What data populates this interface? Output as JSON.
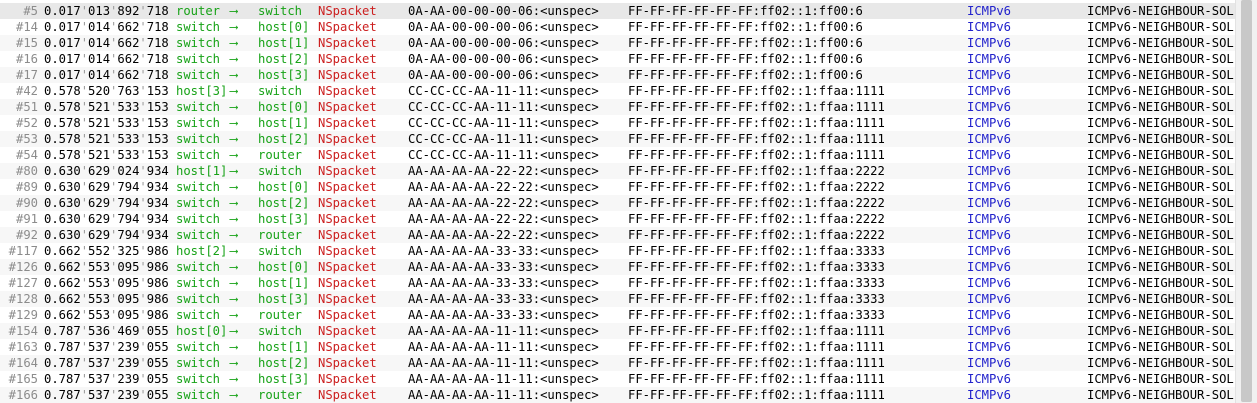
{
  "log": {
    "rows": [
      {
        "num": "#5",
        "t": [
          "0.017",
          "013",
          "892",
          "718"
        ],
        "src": "router",
        "arrow": "⟶",
        "dst": "switch",
        "name": "NSpacket",
        "srcaddr": "0A-AA-00-00-00-06:<unspec>",
        "dstaddr": "FF-FF-FF-FF-FF-FF:ff02::1:ff00:6",
        "proto": "ICMPv6",
        "kind": "ICMPv6-NEIGHBOUR-SOL"
      },
      {
        "num": "#14",
        "t": [
          "0.017",
          "014",
          "662",
          "718"
        ],
        "src": "switch",
        "arrow": "⟶",
        "dst": "host[0]",
        "name": "NSpacket",
        "srcaddr": "0A-AA-00-00-00-06:<unspec>",
        "dstaddr": "FF-FF-FF-FF-FF-FF:ff02::1:ff00:6",
        "proto": "ICMPv6",
        "kind": "ICMPv6-NEIGHBOUR-SOL"
      },
      {
        "num": "#15",
        "t": [
          "0.017",
          "014",
          "662",
          "718"
        ],
        "src": "switch",
        "arrow": "⟶",
        "dst": "host[1]",
        "name": "NSpacket",
        "srcaddr": "0A-AA-00-00-00-06:<unspec>",
        "dstaddr": "FF-FF-FF-FF-FF-FF:ff02::1:ff00:6",
        "proto": "ICMPv6",
        "kind": "ICMPv6-NEIGHBOUR-SOL"
      },
      {
        "num": "#16",
        "t": [
          "0.017",
          "014",
          "662",
          "718"
        ],
        "src": "switch",
        "arrow": "⟶",
        "dst": "host[2]",
        "name": "NSpacket",
        "srcaddr": "0A-AA-00-00-00-06:<unspec>",
        "dstaddr": "FF-FF-FF-FF-FF-FF:ff02::1:ff00:6",
        "proto": "ICMPv6",
        "kind": "ICMPv6-NEIGHBOUR-SOL"
      },
      {
        "num": "#17",
        "t": [
          "0.017",
          "014",
          "662",
          "718"
        ],
        "src": "switch",
        "arrow": "⟶",
        "dst": "host[3]",
        "name": "NSpacket",
        "srcaddr": "0A-AA-00-00-00-06:<unspec>",
        "dstaddr": "FF-FF-FF-FF-FF-FF:ff02::1:ff00:6",
        "proto": "ICMPv6",
        "kind": "ICMPv6-NEIGHBOUR-SOL"
      },
      {
        "num": "#42",
        "t": [
          "0.578",
          "520",
          "763",
          "153"
        ],
        "src": "host[3]",
        "arrow": "⟶",
        "dst": "switch",
        "name": "NSpacket",
        "srcaddr": "CC-CC-CC-AA-11-11:<unspec>",
        "dstaddr": "FF-FF-FF-FF-FF-FF:ff02::1:ffaa:1111",
        "proto": "ICMPv6",
        "kind": "ICMPv6-NEIGHBOUR-SOL"
      },
      {
        "num": "#51",
        "t": [
          "0.578",
          "521",
          "533",
          "153"
        ],
        "src": "switch",
        "arrow": "⟶",
        "dst": "host[0]",
        "name": "NSpacket",
        "srcaddr": "CC-CC-CC-AA-11-11:<unspec>",
        "dstaddr": "FF-FF-FF-FF-FF-FF:ff02::1:ffaa:1111",
        "proto": "ICMPv6",
        "kind": "ICMPv6-NEIGHBOUR-SOL"
      },
      {
        "num": "#52",
        "t": [
          "0.578",
          "521",
          "533",
          "153"
        ],
        "src": "switch",
        "arrow": "⟶",
        "dst": "host[1]",
        "name": "NSpacket",
        "srcaddr": "CC-CC-CC-AA-11-11:<unspec>",
        "dstaddr": "FF-FF-FF-FF-FF-FF:ff02::1:ffaa:1111",
        "proto": "ICMPv6",
        "kind": "ICMPv6-NEIGHBOUR-SOL"
      },
      {
        "num": "#53",
        "t": [
          "0.578",
          "521",
          "533",
          "153"
        ],
        "src": "switch",
        "arrow": "⟶",
        "dst": "host[2]",
        "name": "NSpacket",
        "srcaddr": "CC-CC-CC-AA-11-11:<unspec>",
        "dstaddr": "FF-FF-FF-FF-FF-FF:ff02::1:ffaa:1111",
        "proto": "ICMPv6",
        "kind": "ICMPv6-NEIGHBOUR-SOL"
      },
      {
        "num": "#54",
        "t": [
          "0.578",
          "521",
          "533",
          "153"
        ],
        "src": "switch",
        "arrow": "⟶",
        "dst": "router",
        "name": "NSpacket",
        "srcaddr": "CC-CC-CC-AA-11-11:<unspec>",
        "dstaddr": "FF-FF-FF-FF-FF-FF:ff02::1:ffaa:1111",
        "proto": "ICMPv6",
        "kind": "ICMPv6-NEIGHBOUR-SOL"
      },
      {
        "num": "#80",
        "t": [
          "0.630",
          "629",
          "024",
          "934"
        ],
        "src": "host[1]",
        "arrow": "⟶",
        "dst": "switch",
        "name": "NSpacket",
        "srcaddr": "AA-AA-AA-AA-22-22:<unspec>",
        "dstaddr": "FF-FF-FF-FF-FF-FF:ff02::1:ffaa:2222",
        "proto": "ICMPv6",
        "kind": "ICMPv6-NEIGHBOUR-SOL"
      },
      {
        "num": "#89",
        "t": [
          "0.630",
          "629",
          "794",
          "934"
        ],
        "src": "switch",
        "arrow": "⟶",
        "dst": "host[0]",
        "name": "NSpacket",
        "srcaddr": "AA-AA-AA-AA-22-22:<unspec>",
        "dstaddr": "FF-FF-FF-FF-FF-FF:ff02::1:ffaa:2222",
        "proto": "ICMPv6",
        "kind": "ICMPv6-NEIGHBOUR-SOL"
      },
      {
        "num": "#90",
        "t": [
          "0.630",
          "629",
          "794",
          "934"
        ],
        "src": "switch",
        "arrow": "⟶",
        "dst": "host[2]",
        "name": "NSpacket",
        "srcaddr": "AA-AA-AA-AA-22-22:<unspec>",
        "dstaddr": "FF-FF-FF-FF-FF-FF:ff02::1:ffaa:2222",
        "proto": "ICMPv6",
        "kind": "ICMPv6-NEIGHBOUR-SOL"
      },
      {
        "num": "#91",
        "t": [
          "0.630",
          "629",
          "794",
          "934"
        ],
        "src": "switch",
        "arrow": "⟶",
        "dst": "host[3]",
        "name": "NSpacket",
        "srcaddr": "AA-AA-AA-AA-22-22:<unspec>",
        "dstaddr": "FF-FF-FF-FF-FF-FF:ff02::1:ffaa:2222",
        "proto": "ICMPv6",
        "kind": "ICMPv6-NEIGHBOUR-SOL"
      },
      {
        "num": "#92",
        "t": [
          "0.630",
          "629",
          "794",
          "934"
        ],
        "src": "switch",
        "arrow": "⟶",
        "dst": "router",
        "name": "NSpacket",
        "srcaddr": "AA-AA-AA-AA-22-22:<unspec>",
        "dstaddr": "FF-FF-FF-FF-FF-FF:ff02::1:ffaa:2222",
        "proto": "ICMPv6",
        "kind": "ICMPv6-NEIGHBOUR-SOL"
      },
      {
        "num": "#117",
        "t": [
          "0.662",
          "552",
          "325",
          "986"
        ],
        "src": "host[2]",
        "arrow": "⟶",
        "dst": "switch",
        "name": "NSpacket",
        "srcaddr": "AA-AA-AA-AA-33-33:<unspec>",
        "dstaddr": "FF-FF-FF-FF-FF-FF:ff02::1:ffaa:3333",
        "proto": "ICMPv6",
        "kind": "ICMPv6-NEIGHBOUR-SOL"
      },
      {
        "num": "#126",
        "t": [
          "0.662",
          "553",
          "095",
          "986"
        ],
        "src": "switch",
        "arrow": "⟶",
        "dst": "host[0]",
        "name": "NSpacket",
        "srcaddr": "AA-AA-AA-AA-33-33:<unspec>",
        "dstaddr": "FF-FF-FF-FF-FF-FF:ff02::1:ffaa:3333",
        "proto": "ICMPv6",
        "kind": "ICMPv6-NEIGHBOUR-SOL"
      },
      {
        "num": "#127",
        "t": [
          "0.662",
          "553",
          "095",
          "986"
        ],
        "src": "switch",
        "arrow": "⟶",
        "dst": "host[1]",
        "name": "NSpacket",
        "srcaddr": "AA-AA-AA-AA-33-33:<unspec>",
        "dstaddr": "FF-FF-FF-FF-FF-FF:ff02::1:ffaa:3333",
        "proto": "ICMPv6",
        "kind": "ICMPv6-NEIGHBOUR-SOL"
      },
      {
        "num": "#128",
        "t": [
          "0.662",
          "553",
          "095",
          "986"
        ],
        "src": "switch",
        "arrow": "⟶",
        "dst": "host[3]",
        "name": "NSpacket",
        "srcaddr": "AA-AA-AA-AA-33-33:<unspec>",
        "dstaddr": "FF-FF-FF-FF-FF-FF:ff02::1:ffaa:3333",
        "proto": "ICMPv6",
        "kind": "ICMPv6-NEIGHBOUR-SOL"
      },
      {
        "num": "#129",
        "t": [
          "0.662",
          "553",
          "095",
          "986"
        ],
        "src": "switch",
        "arrow": "⟶",
        "dst": "router",
        "name": "NSpacket",
        "srcaddr": "AA-AA-AA-AA-33-33:<unspec>",
        "dstaddr": "FF-FF-FF-FF-FF-FF:ff02::1:ffaa:3333",
        "proto": "ICMPv6",
        "kind": "ICMPv6-NEIGHBOUR-SOL"
      },
      {
        "num": "#154",
        "t": [
          "0.787",
          "536",
          "469",
          "055"
        ],
        "src": "host[0]",
        "arrow": "⟶",
        "dst": "switch",
        "name": "NSpacket",
        "srcaddr": "AA-AA-AA-AA-11-11:<unspec>",
        "dstaddr": "FF-FF-FF-FF-FF-FF:ff02::1:ffaa:1111",
        "proto": "ICMPv6",
        "kind": "ICMPv6-NEIGHBOUR-SOL"
      },
      {
        "num": "#163",
        "t": [
          "0.787",
          "537",
          "239",
          "055"
        ],
        "src": "switch",
        "arrow": "⟶",
        "dst": "host[1]",
        "name": "NSpacket",
        "srcaddr": "AA-AA-AA-AA-11-11:<unspec>",
        "dstaddr": "FF-FF-FF-FF-FF-FF:ff02::1:ffaa:1111",
        "proto": "ICMPv6",
        "kind": "ICMPv6-NEIGHBOUR-SOL"
      },
      {
        "num": "#164",
        "t": [
          "0.787",
          "537",
          "239",
          "055"
        ],
        "src": "switch",
        "arrow": "⟶",
        "dst": "host[2]",
        "name": "NSpacket",
        "srcaddr": "AA-AA-AA-AA-11-11:<unspec>",
        "dstaddr": "FF-FF-FF-FF-FF-FF:ff02::1:ffaa:1111",
        "proto": "ICMPv6",
        "kind": "ICMPv6-NEIGHBOUR-SOL"
      },
      {
        "num": "#165",
        "t": [
          "0.787",
          "537",
          "239",
          "055"
        ],
        "src": "switch",
        "arrow": "⟶",
        "dst": "host[3]",
        "name": "NSpacket",
        "srcaddr": "AA-AA-AA-AA-11-11:<unspec>",
        "dstaddr": "FF-FF-FF-FF-FF-FF:ff02::1:ffaa:1111",
        "proto": "ICMPv6",
        "kind": "ICMPv6-NEIGHBOUR-SOL"
      },
      {
        "num": "#166",
        "t": [
          "0.787",
          "537",
          "239",
          "055"
        ],
        "src": "switch",
        "arrow": "⟶",
        "dst": "router",
        "name": "NSpacket",
        "srcaddr": "AA-AA-AA-AA-11-11:<unspec>",
        "dstaddr": "FF-FF-FF-FF-FF-FF:ff02::1:ffaa:1111",
        "proto": "ICMPv6",
        "kind": "ICMPv6-NEIGHBOUR-SOL"
      }
    ]
  }
}
